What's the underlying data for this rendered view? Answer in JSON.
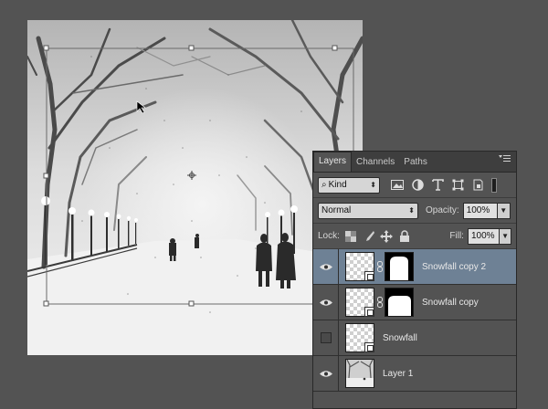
{
  "canvas": {
    "content": "snowy-park-photo",
    "cursor": "arrow-cursor"
  },
  "panel": {
    "tabs": [
      {
        "label": "Layers",
        "active": true
      },
      {
        "label": "Channels",
        "active": false
      },
      {
        "label": "Paths",
        "active": false
      }
    ],
    "menu_icon": "panel-menu-icon",
    "filter": {
      "kind_label": "Kind",
      "icons": [
        "pixel-filter-icon",
        "adjustment-filter-icon",
        "type-filter-icon",
        "shape-filter-icon",
        "smart-object-filter-icon"
      ]
    },
    "blend_mode": "Normal",
    "opacity_label": "Opacity:",
    "opacity_value": "100%",
    "lock_label": "Lock:",
    "lock_icons": [
      "lock-transparent-icon",
      "lock-image-icon",
      "lock-position-icon",
      "lock-all-icon"
    ],
    "fill_label": "Fill:",
    "fill_value": "100%",
    "layers": [
      {
        "name": "Snowfall copy 2",
        "visible": true,
        "selected": true,
        "has_mask": true,
        "smart_object": true,
        "thumb": "checker"
      },
      {
        "name": "Snowfall copy",
        "visible": true,
        "selected": false,
        "has_mask": true,
        "smart_object": true,
        "thumb": "checker"
      },
      {
        "name": "Snowfall",
        "visible": false,
        "selected": false,
        "has_mask": false,
        "smart_object": true,
        "thumb": "checker"
      },
      {
        "name": "Layer 1",
        "visible": true,
        "selected": false,
        "has_mask": false,
        "smart_object": false,
        "thumb": "photo"
      }
    ]
  },
  "colors": {
    "workspace": "#535353",
    "selected_layer": "#6e8195",
    "tab_bar": "#3e3e3e"
  }
}
